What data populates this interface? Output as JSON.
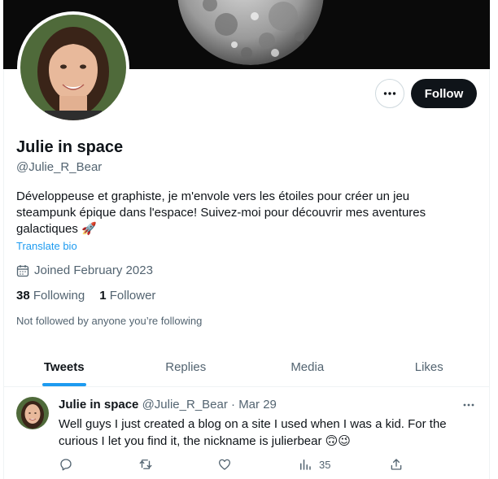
{
  "profile": {
    "display_name": "Julie in space",
    "handle": "@Julie_R_Bear",
    "bio": "Développeuse et graphiste, je m'envole vers les étoiles pour créer un jeu steampunk épique dans l'espace! Suivez-moi pour découvrir mes aventures galactiques 🚀",
    "translate_label": "Translate bio",
    "joined_label": "Joined February 2023",
    "following_count": "38",
    "following_label": "Following",
    "followers_count": "1",
    "followers_label": "Follower",
    "not_followed_text": "Not followed by anyone you’re following"
  },
  "actions": {
    "follow_label": "Follow",
    "more_icon": "more-horizontal-icon"
  },
  "tabs": [
    {
      "label": "Tweets",
      "active": true
    },
    {
      "label": "Replies",
      "active": false
    },
    {
      "label": "Media",
      "active": false
    },
    {
      "label": "Likes",
      "active": false
    }
  ],
  "tweet": {
    "author": "Julie in space",
    "handle": "@Julie_R_Bear",
    "separator": "·",
    "date": "Mar 29",
    "text": "Well guys I just created a blog on a site I used when I was a kid. For the curious I let you find it, the nickname is julierbear 🙃😉",
    "views": "35",
    "icons": [
      "reply-icon",
      "retweet-icon",
      "like-icon",
      "views-icon",
      "share-icon"
    ]
  },
  "colors": {
    "accent": "#1d9bf0",
    "text_primary": "#0f1419",
    "text_secondary": "#536471",
    "banner": "#0a0a0a"
  }
}
